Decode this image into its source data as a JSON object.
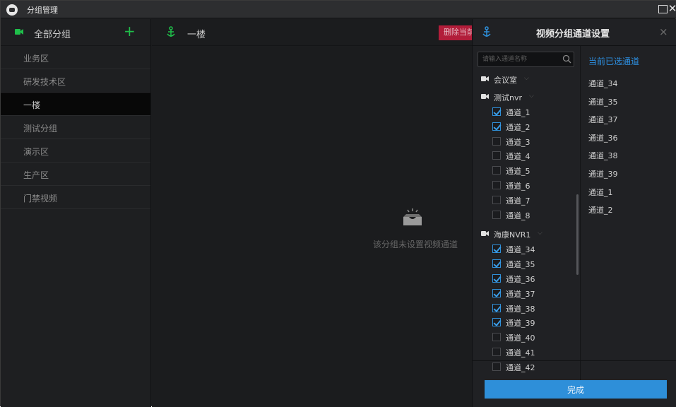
{
  "window": {
    "title": "分组管理"
  },
  "sidebar": {
    "header_label": "全部分组",
    "add_symbol": "+",
    "items": [
      {
        "label": "业务区",
        "selected": false
      },
      {
        "label": "研发技术区",
        "selected": false
      },
      {
        "label": "一楼",
        "selected": true
      },
      {
        "label": "测试分组",
        "selected": false
      },
      {
        "label": "演示区",
        "selected": false
      },
      {
        "label": "生产区",
        "selected": false
      },
      {
        "label": "门禁视频",
        "selected": false
      }
    ]
  },
  "main": {
    "group_name": "一楼",
    "delete_label": "删除当前",
    "empty_text": "该分组未设置视频通道"
  },
  "panel": {
    "title": "视频分组通道设置",
    "close_symbol": "×",
    "search_placeholder": "请输入通道名称",
    "selected_header": "当前已选通道",
    "selected_items": [
      "通道_34",
      "通道_35",
      "通道_37",
      "通道_36",
      "通道_38",
      "通道_39",
      "通道_1",
      "通道_2"
    ],
    "done_label": "完成",
    "devices": [
      {
        "name": "会议室",
        "channels": []
      },
      {
        "name": "测试nvr",
        "channels": [
          {
            "name": "通道_1",
            "checked": true
          },
          {
            "name": "通道_2",
            "checked": true
          },
          {
            "name": "通道_3",
            "checked": false
          },
          {
            "name": "通道_4",
            "checked": false
          },
          {
            "name": "通道_5",
            "checked": false
          },
          {
            "name": "通道_6",
            "checked": false
          },
          {
            "name": "通道_7",
            "checked": false
          },
          {
            "name": "通道_8",
            "checked": false
          }
        ]
      },
      {
        "name": "海康NVR1",
        "channels": [
          {
            "name": "通道_34",
            "checked": true
          },
          {
            "name": "通道_35",
            "checked": true
          },
          {
            "name": "通道_36",
            "checked": true
          },
          {
            "name": "通道_37",
            "checked": true
          },
          {
            "name": "通道_38",
            "checked": true
          },
          {
            "name": "通道_39",
            "checked": true
          },
          {
            "name": "通道_40",
            "checked": false
          },
          {
            "name": "通道_41",
            "checked": false
          },
          {
            "name": "通道_42",
            "checked": false
          }
        ]
      }
    ]
  },
  "colors": {
    "accent": "#2e8fd9",
    "add_green": "#1fbf4a",
    "delete_red": "#b21d3a",
    "background": "#1b1c1e"
  }
}
